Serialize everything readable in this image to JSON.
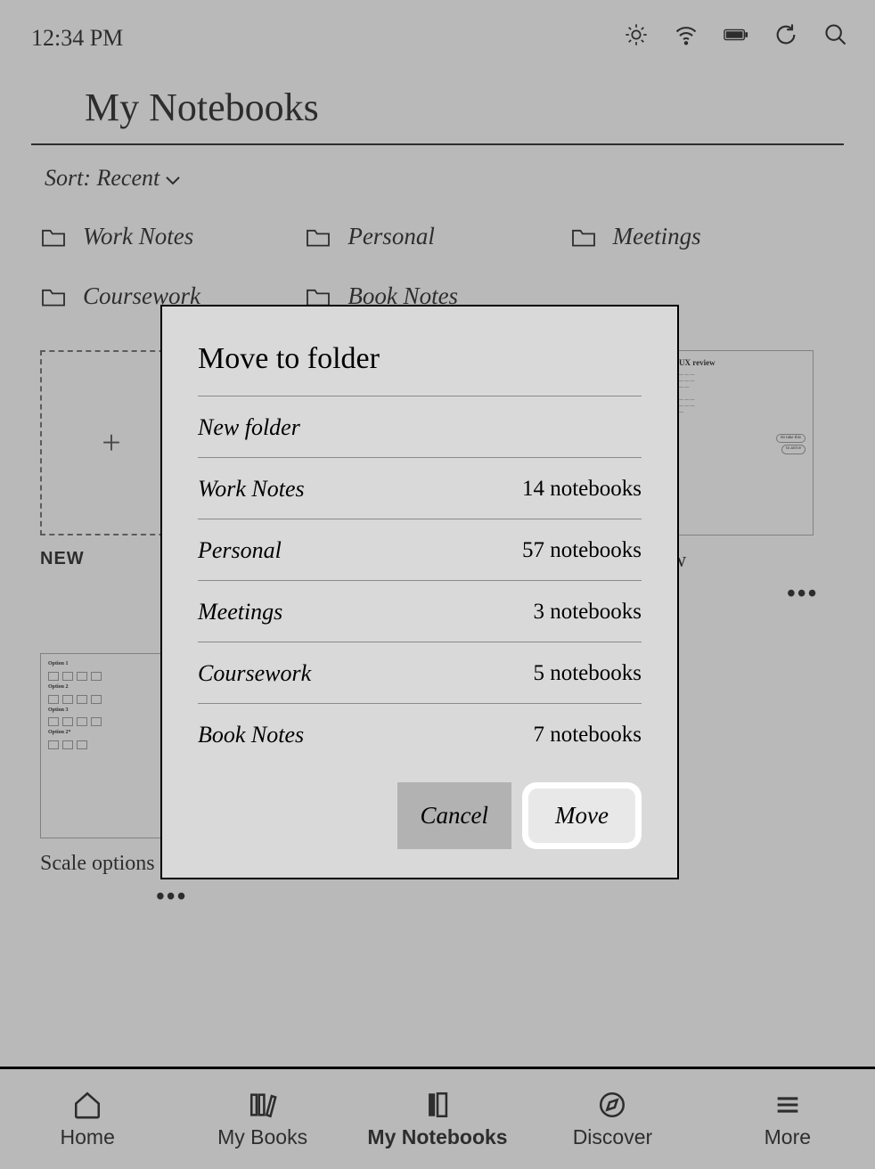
{
  "status": {
    "time": "12:34 PM"
  },
  "header": {
    "title": "My Notebooks"
  },
  "sort": {
    "label": "Sort: Recent"
  },
  "folders": [
    {
      "name": "Work Notes"
    },
    {
      "name": "Personal"
    },
    {
      "name": "Meetings"
    },
    {
      "name": "Coursework"
    },
    {
      "name": "Book Notes"
    }
  ],
  "newLabel": "NEW",
  "notebooks": [
    {
      "label": "…"
    },
    {
      "label": "…UX review",
      "menu": "•••"
    },
    {
      "label": "Scale options",
      "menu": "•••"
    }
  ],
  "modal": {
    "title": "Move to folder",
    "new_folder": "New folder",
    "folders": [
      {
        "name": "Work Notes",
        "count": "14 notebooks"
      },
      {
        "name": "Personal",
        "count": "57 notebooks"
      },
      {
        "name": "Meetings",
        "count": "3 notebooks"
      },
      {
        "name": "Coursework",
        "count": "5 notebooks"
      },
      {
        "name": "Book Notes",
        "count": "7 notebooks"
      }
    ],
    "cancel": "Cancel",
    "move": "Move"
  },
  "tabs": {
    "home": "Home",
    "mybooks": "My Books",
    "mynotebooks": "My Notebooks",
    "discover": "Discover",
    "more": "More"
  }
}
